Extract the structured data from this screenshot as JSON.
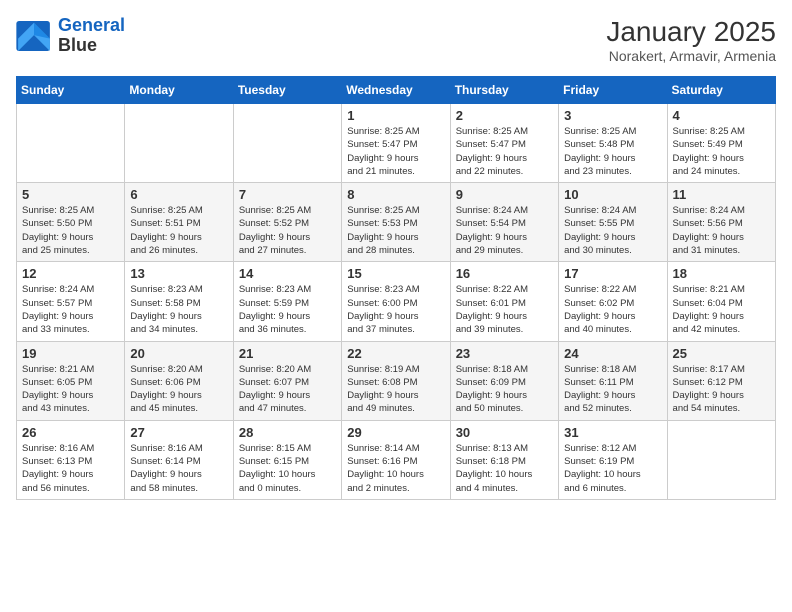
{
  "logo": {
    "line1": "General",
    "line2": "Blue"
  },
  "title": "January 2025",
  "location": "Norakert, Armavir, Armenia",
  "weekdays": [
    "Sunday",
    "Monday",
    "Tuesday",
    "Wednesday",
    "Thursday",
    "Friday",
    "Saturday"
  ],
  "weeks": [
    [
      {
        "day": "",
        "info": ""
      },
      {
        "day": "",
        "info": ""
      },
      {
        "day": "",
        "info": ""
      },
      {
        "day": "1",
        "info": "Sunrise: 8:25 AM\nSunset: 5:47 PM\nDaylight: 9 hours\nand 21 minutes."
      },
      {
        "day": "2",
        "info": "Sunrise: 8:25 AM\nSunset: 5:47 PM\nDaylight: 9 hours\nand 22 minutes."
      },
      {
        "day": "3",
        "info": "Sunrise: 8:25 AM\nSunset: 5:48 PM\nDaylight: 9 hours\nand 23 minutes."
      },
      {
        "day": "4",
        "info": "Sunrise: 8:25 AM\nSunset: 5:49 PM\nDaylight: 9 hours\nand 24 minutes."
      }
    ],
    [
      {
        "day": "5",
        "info": "Sunrise: 8:25 AM\nSunset: 5:50 PM\nDaylight: 9 hours\nand 25 minutes."
      },
      {
        "day": "6",
        "info": "Sunrise: 8:25 AM\nSunset: 5:51 PM\nDaylight: 9 hours\nand 26 minutes."
      },
      {
        "day": "7",
        "info": "Sunrise: 8:25 AM\nSunset: 5:52 PM\nDaylight: 9 hours\nand 27 minutes."
      },
      {
        "day": "8",
        "info": "Sunrise: 8:25 AM\nSunset: 5:53 PM\nDaylight: 9 hours\nand 28 minutes."
      },
      {
        "day": "9",
        "info": "Sunrise: 8:24 AM\nSunset: 5:54 PM\nDaylight: 9 hours\nand 29 minutes."
      },
      {
        "day": "10",
        "info": "Sunrise: 8:24 AM\nSunset: 5:55 PM\nDaylight: 9 hours\nand 30 minutes."
      },
      {
        "day": "11",
        "info": "Sunrise: 8:24 AM\nSunset: 5:56 PM\nDaylight: 9 hours\nand 31 minutes."
      }
    ],
    [
      {
        "day": "12",
        "info": "Sunrise: 8:24 AM\nSunset: 5:57 PM\nDaylight: 9 hours\nand 33 minutes."
      },
      {
        "day": "13",
        "info": "Sunrise: 8:23 AM\nSunset: 5:58 PM\nDaylight: 9 hours\nand 34 minutes."
      },
      {
        "day": "14",
        "info": "Sunrise: 8:23 AM\nSunset: 5:59 PM\nDaylight: 9 hours\nand 36 minutes."
      },
      {
        "day": "15",
        "info": "Sunrise: 8:23 AM\nSunset: 6:00 PM\nDaylight: 9 hours\nand 37 minutes."
      },
      {
        "day": "16",
        "info": "Sunrise: 8:22 AM\nSunset: 6:01 PM\nDaylight: 9 hours\nand 39 minutes."
      },
      {
        "day": "17",
        "info": "Sunrise: 8:22 AM\nSunset: 6:02 PM\nDaylight: 9 hours\nand 40 minutes."
      },
      {
        "day": "18",
        "info": "Sunrise: 8:21 AM\nSunset: 6:04 PM\nDaylight: 9 hours\nand 42 minutes."
      }
    ],
    [
      {
        "day": "19",
        "info": "Sunrise: 8:21 AM\nSunset: 6:05 PM\nDaylight: 9 hours\nand 43 minutes."
      },
      {
        "day": "20",
        "info": "Sunrise: 8:20 AM\nSunset: 6:06 PM\nDaylight: 9 hours\nand 45 minutes."
      },
      {
        "day": "21",
        "info": "Sunrise: 8:20 AM\nSunset: 6:07 PM\nDaylight: 9 hours\nand 47 minutes."
      },
      {
        "day": "22",
        "info": "Sunrise: 8:19 AM\nSunset: 6:08 PM\nDaylight: 9 hours\nand 49 minutes."
      },
      {
        "day": "23",
        "info": "Sunrise: 8:18 AM\nSunset: 6:09 PM\nDaylight: 9 hours\nand 50 minutes."
      },
      {
        "day": "24",
        "info": "Sunrise: 8:18 AM\nSunset: 6:11 PM\nDaylight: 9 hours\nand 52 minutes."
      },
      {
        "day": "25",
        "info": "Sunrise: 8:17 AM\nSunset: 6:12 PM\nDaylight: 9 hours\nand 54 minutes."
      }
    ],
    [
      {
        "day": "26",
        "info": "Sunrise: 8:16 AM\nSunset: 6:13 PM\nDaylight: 9 hours\nand 56 minutes."
      },
      {
        "day": "27",
        "info": "Sunrise: 8:16 AM\nSunset: 6:14 PM\nDaylight: 9 hours\nand 58 minutes."
      },
      {
        "day": "28",
        "info": "Sunrise: 8:15 AM\nSunset: 6:15 PM\nDaylight: 10 hours\nand 0 minutes."
      },
      {
        "day": "29",
        "info": "Sunrise: 8:14 AM\nSunset: 6:16 PM\nDaylight: 10 hours\nand 2 minutes."
      },
      {
        "day": "30",
        "info": "Sunrise: 8:13 AM\nSunset: 6:18 PM\nDaylight: 10 hours\nand 4 minutes."
      },
      {
        "day": "31",
        "info": "Sunrise: 8:12 AM\nSunset: 6:19 PM\nDaylight: 10 hours\nand 6 minutes."
      },
      {
        "day": "",
        "info": ""
      }
    ]
  ]
}
